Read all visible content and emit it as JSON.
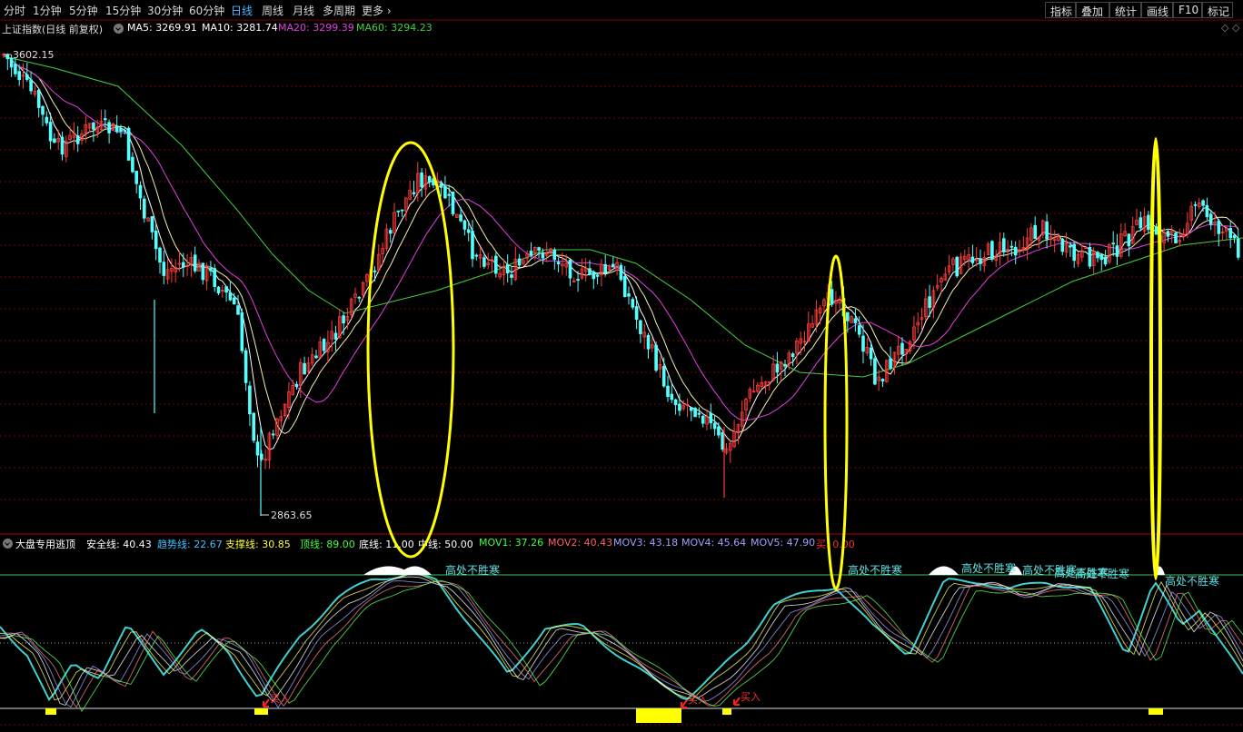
{
  "toolbar": {
    "periods": [
      "分时",
      "1分钟",
      "5分钟",
      "15分钟",
      "30分钟",
      "60分钟",
      "日线",
      "周线",
      "月线",
      "多周期",
      "更多"
    ],
    "active_period": "日线",
    "right_buttons": [
      "指标",
      "叠加",
      "统计",
      "画线",
      "F10",
      "标记"
    ]
  },
  "main_chart": {
    "title": "上证指数(日线 前复权)",
    "ma_labels": [
      {
        "label": "MA5: 3269.91",
        "color": "#ffffff"
      },
      {
        "label": "MA10: 3281.74",
        "color": "#ffffff"
      },
      {
        "label": "MA20: 3299.39",
        "color": "#e040e0"
      },
      {
        "label": "MA60: 3294.23",
        "color": "#40d040"
      }
    ],
    "high_label": "3602.15",
    "low_label": "2863.65"
  },
  "indicator": {
    "name": "大盘专用逃顶",
    "params": [
      {
        "label": "安全线: 40.43",
        "color": "#ffffff"
      },
      {
        "label": "趋势线: 22.67",
        "color": "#40c0ff"
      },
      {
        "label": "支撑线: 30.85",
        "color": "#ffff40"
      },
      {
        "label": "顶线: 89.00",
        "color": "#40ff40"
      },
      {
        "label": "底线: 11.00",
        "color": "#ffffff"
      },
      {
        "label": "中线: 50.00",
        "color": "#ffffff"
      },
      {
        "label": "MOV1: 37.26",
        "color": "#40ff40"
      },
      {
        "label": "MOV2: 40.43",
        "color": "#ff6060"
      },
      {
        "label": "MOV3: 43.18",
        "color": "#a0a0ff"
      },
      {
        "label": "MOV4: 45.64",
        "color": "#a0a0ff"
      },
      {
        "label": "MOV5: 47.90",
        "color": "#a0a0ff"
      },
      {
        "label": "买: 0.00",
        "color": "#ff3030"
      }
    ],
    "top_signal_text": "高处不胜寒",
    "buy_signal_text": "买入"
  },
  "colors": {
    "up": "#ff3b3b",
    "down": "#54ffff",
    "ma5": "#ffffff",
    "ma20": "#e040e0",
    "ma60": "#40d040",
    "highlight": "#ffff00",
    "grid": "#7a0000"
  }
}
